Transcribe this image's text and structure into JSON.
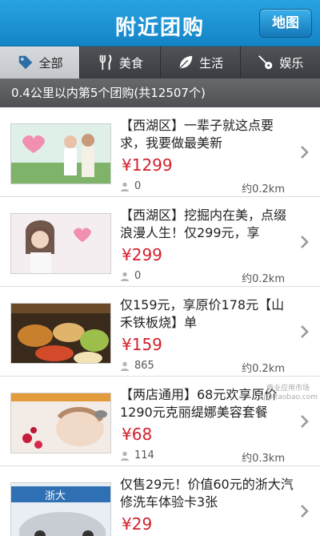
{
  "header": {
    "title": "附近团购",
    "map_button": "地图"
  },
  "tabs": [
    {
      "label": "全部",
      "icon": "tag-icon",
      "active": true
    },
    {
      "label": "美食",
      "icon": "fork-knife-icon",
      "active": false
    },
    {
      "label": "生活",
      "icon": "leaf-icon",
      "active": false
    },
    {
      "label": "娱乐",
      "icon": "guitar-icon",
      "active": false
    }
  ],
  "summary": "0.4公里以内第5个团购(共12507个)",
  "deals": [
    {
      "title": "【西湖区】一辈子就这点要求，我要做最美新",
      "price": "¥1299",
      "buyers": "0",
      "distance": "约0.2km",
      "image": "wedding-photo"
    },
    {
      "title": "【西湖区】挖掘内在美，点缀浪漫人生！仅299元，享",
      "price": "¥299",
      "buyers": "0",
      "distance": "约0.2km",
      "image": "portrait-photo"
    },
    {
      "title": "仅159元，享原价178元【山禾铁板烧】单",
      "price": "¥159",
      "buyers": "865",
      "distance": "约0.2km",
      "image": "teppanyaki-photo"
    },
    {
      "title": "【两店通用】68元欢享原价1290元克丽缇娜美容套餐",
      "price": "¥68",
      "buyers": "114",
      "distance": "约0.3km",
      "image": "spa-photo"
    },
    {
      "title": "仅售29元！价值60元的浙大汽修洗车体验卡3张",
      "price": "¥29",
      "buyers": "",
      "distance": "",
      "image": "car-wash-photo"
    }
  ],
  "watermark": {
    "line1": "商业应用市场",
    "line2": "app.taobao.com"
  },
  "colors": {
    "header": "#1a8fd3",
    "price": "#d3202d",
    "tab_active": "#cfd2d5"
  }
}
